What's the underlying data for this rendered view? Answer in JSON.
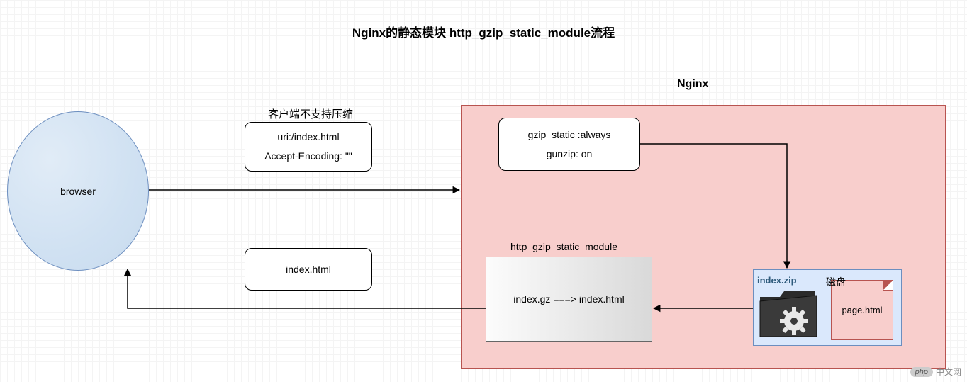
{
  "title": "Nginx的静态模块 http_gzip_static_module流程",
  "nginx_label": "Nginx",
  "browser_label": "browser",
  "client_note": "客户端不支持压缩",
  "request": {
    "uri": "uri:/index.html",
    "encoding": "Accept-Encoding: \"\""
  },
  "response": {
    "file": "index.html"
  },
  "config": {
    "gzip_static": "gzip_static :always",
    "gunzip": "gunzip: on"
  },
  "module": {
    "label": "http_gzip_static_module",
    "transform": "index.gz ===> index.html"
  },
  "disk": {
    "label": "磁盘",
    "zip_label": "index.zip",
    "page_file": "page.html"
  },
  "watermark": "中文网"
}
